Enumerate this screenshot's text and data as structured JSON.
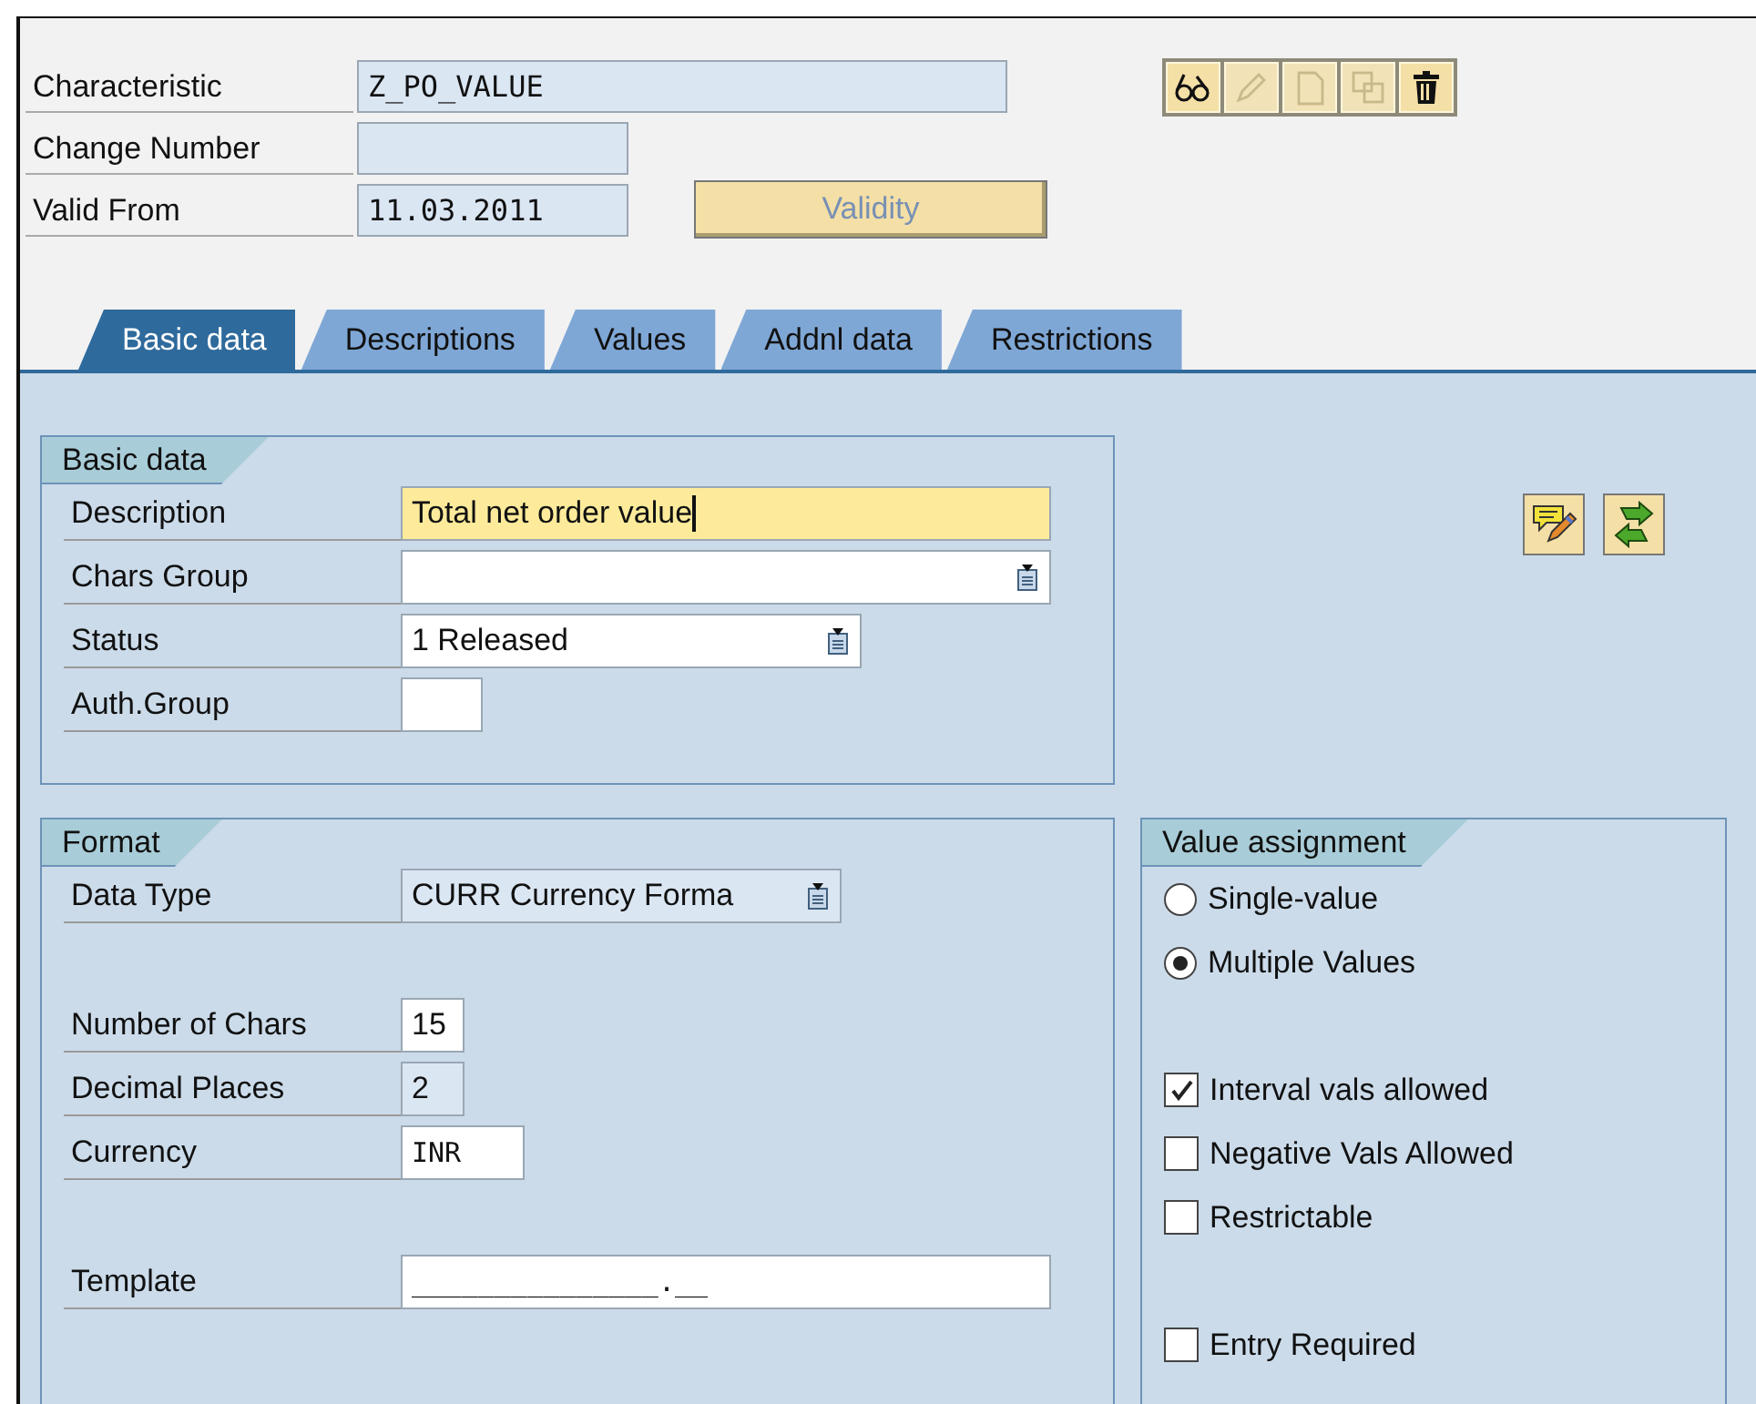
{
  "header": {
    "fields": [
      {
        "label": "Characteristic",
        "value": "Z_PO_VALUE"
      },
      {
        "label": "Change Number"
      },
      {
        "label": "Valid From",
        "value": "11.03.2011"
      }
    ],
    "validity_button": "Validity",
    "toolbar": [
      {
        "kind": "display",
        "disabled": false
      },
      {
        "kind": "edit",
        "disabled": true
      },
      {
        "kind": "create",
        "disabled": true
      },
      {
        "kind": "copy",
        "disabled": true
      },
      {
        "kind": "delete",
        "disabled": false
      }
    ]
  },
  "tabs": [
    {
      "label": "Basic data",
      "selected": true
    },
    {
      "label": "Descriptions",
      "selected": false
    },
    {
      "label": "Values",
      "selected": false
    },
    {
      "label": "Addnl data",
      "selected": false
    },
    {
      "label": "Restrictions",
      "selected": false
    }
  ],
  "basic_data": {
    "title": "Basic data",
    "fields": [
      {
        "label": "Description",
        "value": "Total net order value",
        "kind": "input",
        "focused": true
      },
      {
        "label": "Chars Group",
        "kind": "dropdown"
      },
      {
        "label": "Status",
        "value": "1 Released",
        "kind": "dropdown"
      },
      {
        "label": "Auth.Group",
        "kind": "input"
      }
    ]
  },
  "side_buttons": [
    {
      "kind": "edit-note"
    },
    {
      "kind": "swap"
    }
  ],
  "format": {
    "title": "Format",
    "fields": [
      {
        "label": "Data Type",
        "value": "CURR Currency Forma",
        "kind": "dropdown",
        "readonly": true
      },
      {
        "label": "Number of Chars",
        "value": "15",
        "kind": "input"
      },
      {
        "label": "Decimal Places",
        "value": "2",
        "kind": "input",
        "readonly": true
      },
      {
        "label": "Currency",
        "value": "INR",
        "kind": "code"
      },
      {
        "label": "Template",
        "value": "_______________.__",
        "kind": "code"
      }
    ]
  },
  "value_assignment": {
    "title": "Value assignment",
    "options": [
      {
        "label": "Single-value",
        "kind": "radio",
        "selected": false
      },
      {
        "label": "Multiple Values",
        "kind": "radio",
        "selected": true
      },
      {
        "label": "Interval vals allowed",
        "kind": "checkbox",
        "checked": true
      },
      {
        "label": "Negative Vals Allowed",
        "kind": "checkbox",
        "checked": false
      },
      {
        "label": "Restrictable",
        "kind": "checkbox",
        "checked": false
      },
      {
        "label": "Entry Required",
        "kind": "checkbox",
        "checked": false
      }
    ]
  }
}
